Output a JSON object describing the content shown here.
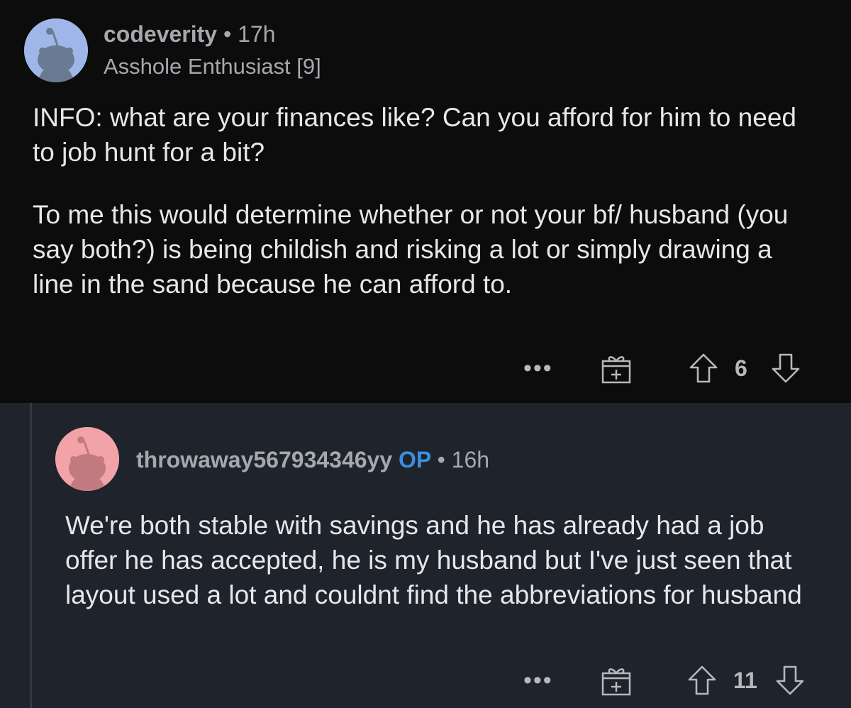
{
  "comment": {
    "username": "codeverity",
    "separator": "•",
    "time": "17h",
    "flair": "Asshole Enthusiast [9]",
    "avatar_color": "#9fb7e8",
    "paragraphs": [
      "INFO: what are your finances like? Can you afford for him to need to job hunt for a bit?",
      "To me this would determine whether or not your bf/ husband (you say both?) is being childish and risking a lot or simply drawing a line in the sand because he can afford to."
    ],
    "vote_count": "6",
    "more_label": "•••"
  },
  "reply": {
    "username": "throwaway567934346yy",
    "op_badge": "OP",
    "separator": "•",
    "time": "16h",
    "avatar_color": "#f2a3a8",
    "paragraphs": [
      "We're both stable with savings and he has already had a job offer he has accepted, he is my husband but I've just seen that layout used a lot and couldnt find the abbreviations for husband"
    ],
    "vote_count": "11",
    "more_label": "•••"
  },
  "icons": {
    "more": "more-options-icon",
    "award": "gift-award-icon",
    "upvote": "upvote-arrow-icon",
    "downvote": "downvote-arrow-icon"
  }
}
